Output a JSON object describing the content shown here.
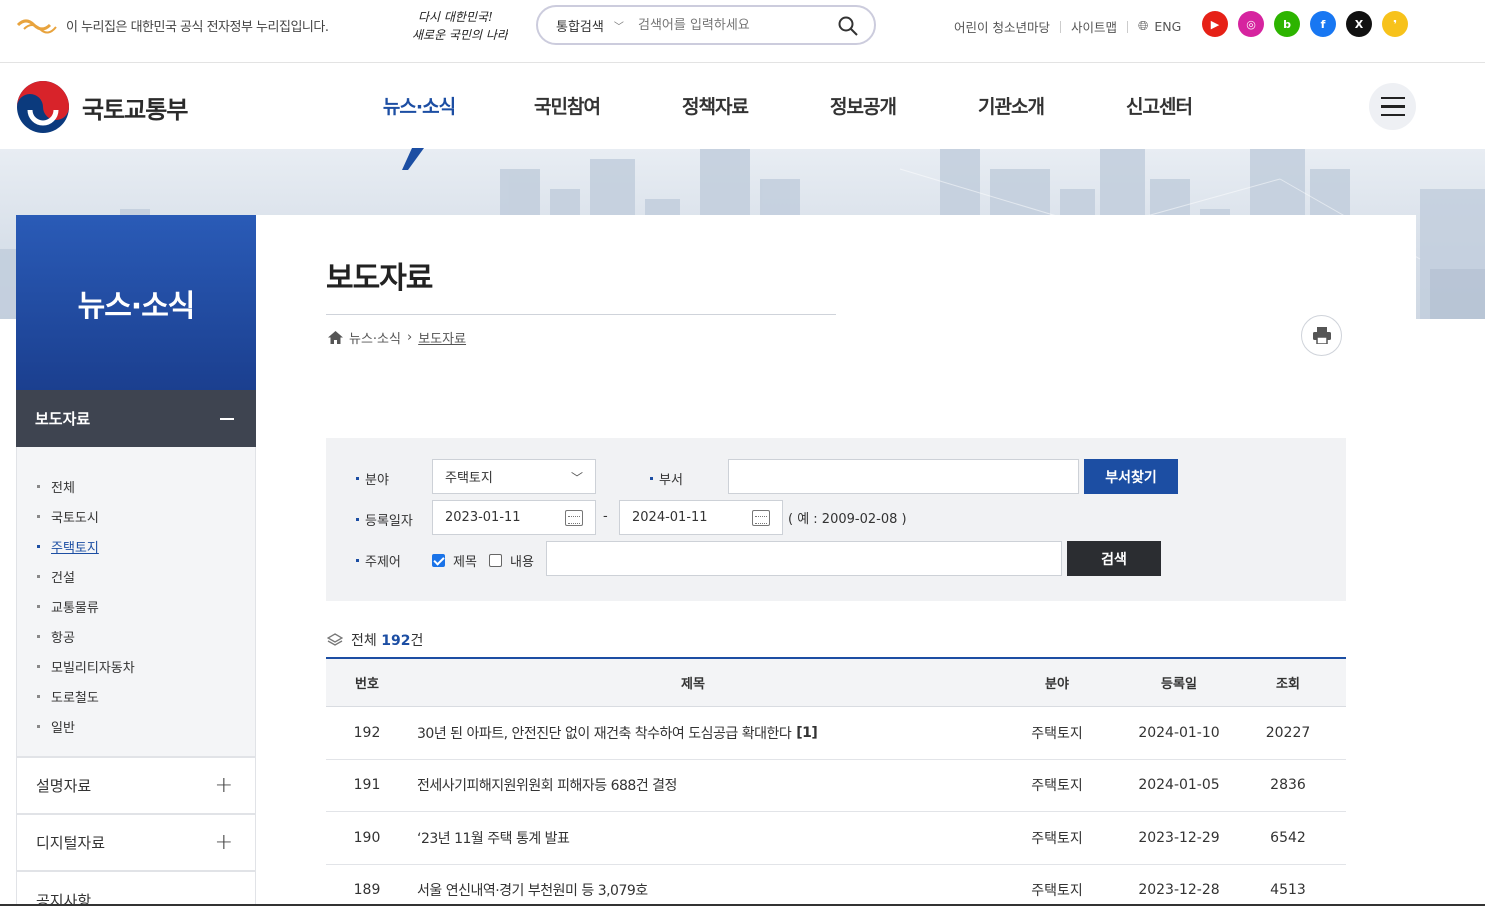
{
  "topbar": {
    "gov_notice": "이 누리집은 대한민국 공식 전자정부 누리집입니다.",
    "search_scope": "통합검색",
    "search_placeholder": "검색어를 입력하세요",
    "links": [
      "어린이 청소년마당",
      "사이트맵",
      "ENG"
    ],
    "sns": [
      {
        "name": "youtube-icon",
        "color": "#e62117",
        "glyph": "▶"
      },
      {
        "name": "instagram-icon",
        "color": "#d6249f",
        "glyph": "◎"
      },
      {
        "name": "blog-icon",
        "color": "#2db400",
        "glyph": "b"
      },
      {
        "name": "facebook-icon",
        "color": "#1877f2",
        "glyph": "f"
      },
      {
        "name": "x-icon",
        "color": "#111111",
        "glyph": "X"
      },
      {
        "name": "kakao-icon",
        "color": "#f7c21b",
        "glyph": "❜"
      }
    ]
  },
  "brand": {
    "name": "국토교통부"
  },
  "gnb": {
    "items": [
      "뉴스·소식",
      "국민참여",
      "정책자료",
      "정보공개",
      "기관소개",
      "신고센터"
    ],
    "active_index": 0
  },
  "sidebar": {
    "title": "뉴스·소식",
    "active_group": "보도자료",
    "sub_items": [
      "전체",
      "국토도시",
      "주택토지",
      "건설",
      "교통물류",
      "항공",
      "모빌리티자동차",
      "도로철도",
      "일반"
    ],
    "active_sub": "주택토지",
    "groups": [
      "설명자료",
      "디지털자료",
      "공지사항"
    ]
  },
  "page": {
    "title": "보도자료",
    "breadcrumb": [
      "뉴스·소식",
      "보도자료"
    ]
  },
  "search": {
    "field_label": "분야",
    "field_value": "주택토지",
    "dept_label": "부서",
    "dept_value": "",
    "dept_button": "부서찾기",
    "date_label": "등록일자",
    "date_from": "2023-01-11",
    "date_to": "2024-01-11",
    "date_sep": "-",
    "date_hint": "( 예 : 2009-02-08 )",
    "keyword_label": "주제어",
    "chk_title": "제목",
    "chk_title_checked": true,
    "chk_content": "내용",
    "chk_content_checked": false,
    "search_button": "검색"
  },
  "list": {
    "total_label": "전체",
    "total_count": "192",
    "total_unit": "건",
    "columns": [
      "번호",
      "제목",
      "분야",
      "등록일",
      "조회"
    ],
    "rows": [
      {
        "no": "192",
        "title": "30년 된 아파트, 안전진단 없이 재건축 착수하여 도심공급 확대한다",
        "comments": "[1]",
        "field": "주택토지",
        "date": "2024-01-10",
        "views": "20227"
      },
      {
        "no": "191",
        "title": "전세사기피해지원위원회 피해자등 688건 결정",
        "comments": "",
        "field": "주택토지",
        "date": "2024-01-05",
        "views": "2836"
      },
      {
        "no": "190",
        "title": "‘23년 11월 주택 통계 발표",
        "comments": "",
        "field": "주택토지",
        "date": "2023-12-29",
        "views": "6542"
      },
      {
        "no": "189",
        "title": "서울 연신내역·경기 부천원미 등 3,079호",
        "comments": "",
        "field": "주택토지",
        "date": "2023-12-28",
        "views": "4513"
      }
    ]
  }
}
